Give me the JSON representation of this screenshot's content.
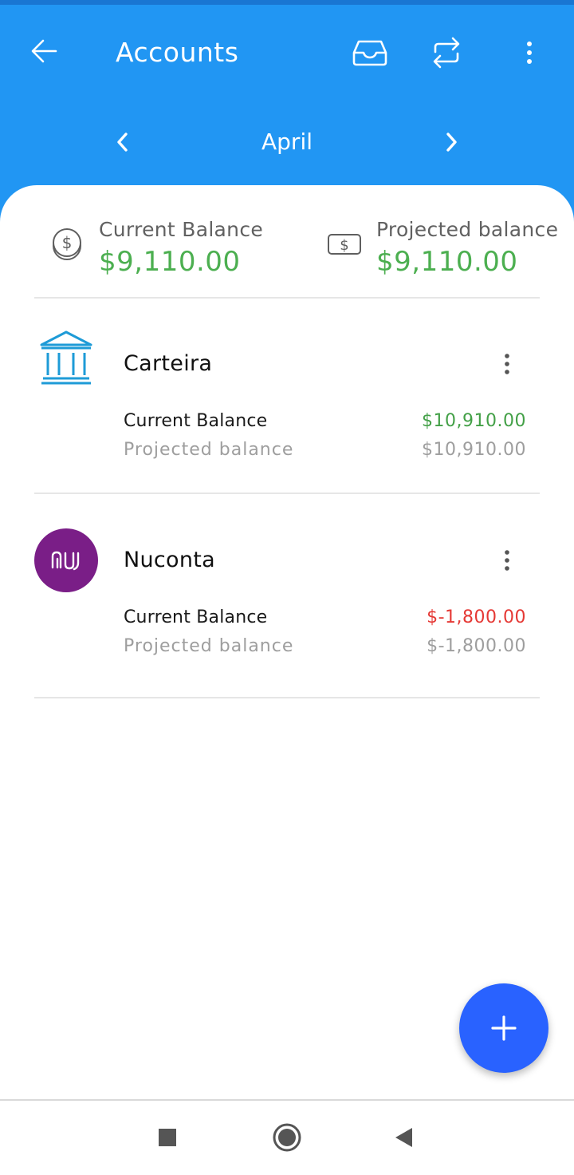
{
  "header": {
    "title": "Accounts",
    "month": "April",
    "icons": {
      "back": "arrow-left-icon",
      "inbox": "inbox-icon",
      "swap": "swap-arrows-icon",
      "more": "more-vertical-icon",
      "prev": "chevron-left-icon",
      "next": "chevron-right-icon"
    }
  },
  "summary": {
    "current": {
      "label": "Current Balance",
      "value": "$9,110.00",
      "icon": "dollar-coin-icon"
    },
    "projected": {
      "label": "Projected balance",
      "value": "$9,110.00",
      "icon": "dollar-bill-icon"
    }
  },
  "accounts": [
    {
      "name": "Carteira",
      "icon": "bank-icon",
      "current_label": "Current Balance",
      "current_value": "$10,910.00",
      "current_color": "#43A047",
      "projected_label": "Projected balance",
      "projected_value": "$10,910.00"
    },
    {
      "name": "Nuconta",
      "icon": "nubank-logo",
      "current_label": "Current Balance",
      "current_value": "$-1,800.00",
      "current_color": "#E53935",
      "projected_label": "Projected balance",
      "projected_value": "$-1,800.00"
    }
  ],
  "fab": {
    "icon": "plus-icon"
  },
  "navbar": {
    "icons": [
      "recents-square-icon",
      "home-circle-icon",
      "back-triangle-icon"
    ]
  },
  "colors": {
    "primary": "#2196F3",
    "positive": "#4CAF50",
    "negative": "#E53935",
    "fab": "#2962FF",
    "nubank": "#7A1E87",
    "bank_icon": "#1E9BD7"
  }
}
